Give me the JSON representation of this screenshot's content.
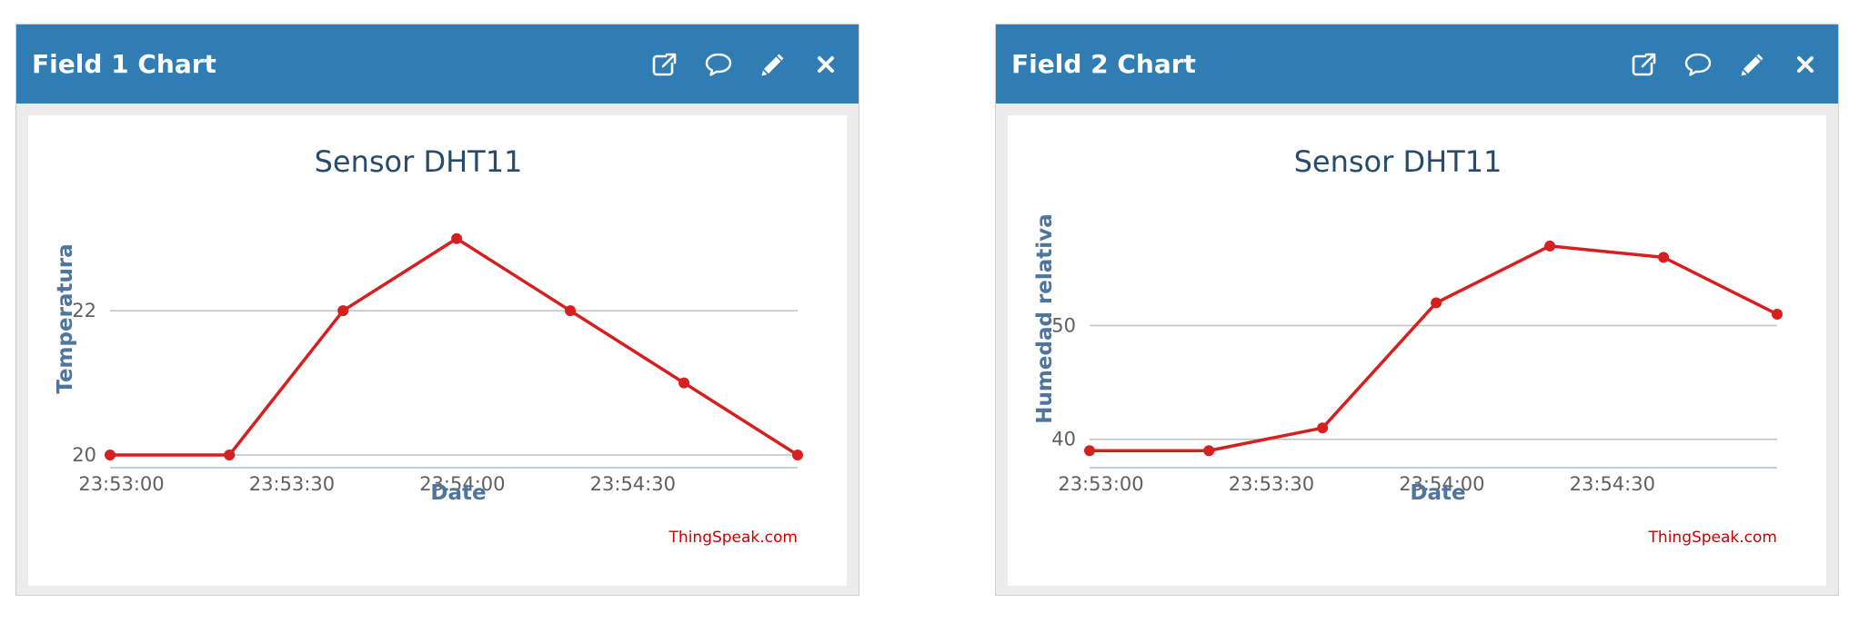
{
  "widgets": [
    {
      "title": "Field 1 Chart",
      "icons": [
        "external-link-icon",
        "comment-icon",
        "pencil-icon",
        "close-icon"
      ],
      "chart_data": {
        "type": "line",
        "title": "Sensor DHT11",
        "xlabel": "Date",
        "ylabel": "Temperatura",
        "credit": "ThingSpeak.com",
        "x_ticks": [
          "23:53:00",
          "23:53:30",
          "23:54:00",
          "23:54:30"
        ],
        "y_ticks": [
          "20",
          "22"
        ],
        "line_color": "#d62020",
        "series": [
          {
            "x": [
              "23:52:58",
              "23:53:19",
              "23:53:39",
              "23:53:59",
              "23:54:19",
              "23:54:39",
              "23:54:59"
            ],
            "y": [
              20,
              20,
              22,
              23,
              22,
              21,
              20
            ]
          }
        ]
      }
    },
    {
      "title": "Field 2 Chart",
      "icons": [
        "external-link-icon",
        "comment-icon",
        "pencil-icon",
        "close-icon"
      ],
      "chart_data": {
        "type": "line",
        "title": "Sensor DHT11",
        "xlabel": "Date",
        "ylabel": "Humedad relativa",
        "credit": "ThingSpeak.com",
        "x_ticks": [
          "23:53:00",
          "23:53:30",
          "23:54:00",
          "23:54:30"
        ],
        "y_ticks": [
          "40",
          "50"
        ],
        "line_color": "#d62020",
        "series": [
          {
            "x": [
              "23:52:58",
              "23:53:19",
              "23:53:39",
              "23:53:59",
              "23:54:19",
              "23:54:39",
              "23:54:59"
            ],
            "y": [
              39,
              39,
              41,
              52,
              57,
              56,
              51
            ]
          }
        ]
      }
    }
  ],
  "colors": {
    "header": "#2f7db3",
    "title_text": "#274b6d",
    "axis_title": "#4d759e",
    "line": "#d62020",
    "credit": "#cc0000"
  }
}
